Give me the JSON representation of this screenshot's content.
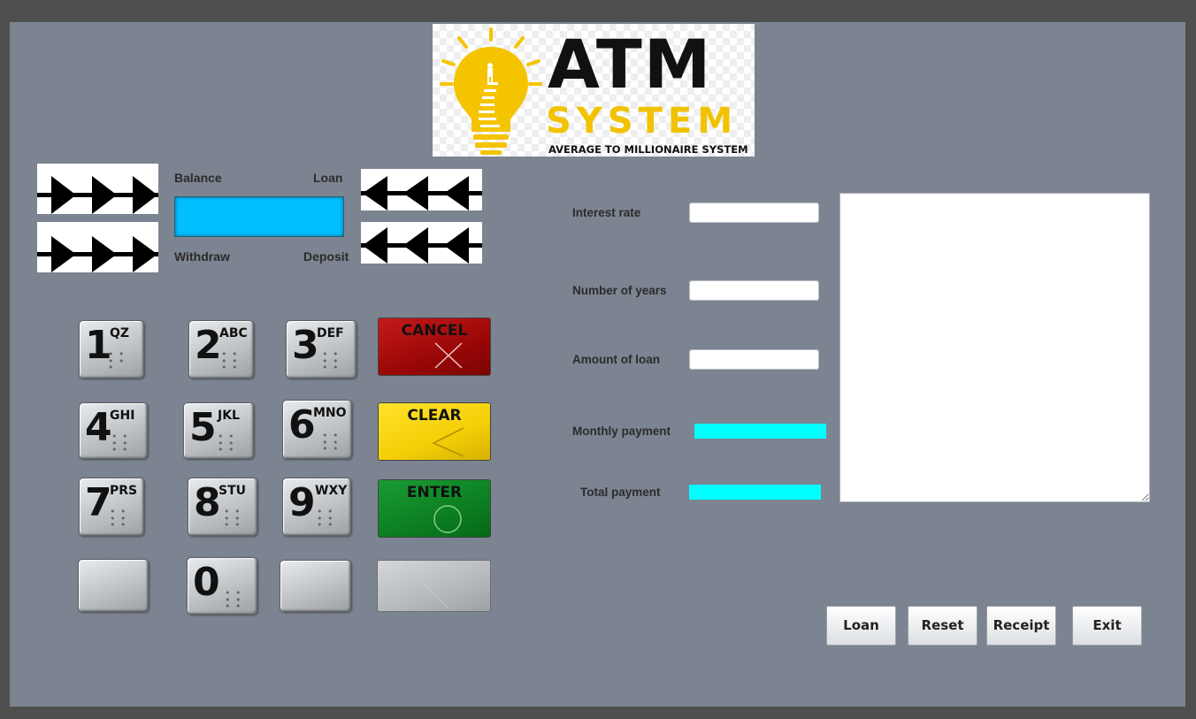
{
  "logo": {
    "title": "ATM",
    "subtitle": "SYSTEM",
    "tagline": "AVERAGE TO MILLIONAIRE SYSTEM"
  },
  "atm_panel": {
    "balance_label": "Balance",
    "loan_label": "Loan",
    "withdraw_label": "Withdraw",
    "deposit_label": "Deposit"
  },
  "keypad": {
    "keys": [
      {
        "digit": "1",
        "letters": "QZ"
      },
      {
        "digit": "2",
        "letters": "ABC"
      },
      {
        "digit": "3",
        "letters": "DEF"
      },
      {
        "digit": "4",
        "letters": "GHI"
      },
      {
        "digit": "5",
        "letters": "JKL"
      },
      {
        "digit": "6",
        "letters": "MNO"
      },
      {
        "digit": "7",
        "letters": "PRS"
      },
      {
        "digit": "8",
        "letters": "STU"
      },
      {
        "digit": "9",
        "letters": "WXY"
      },
      {
        "digit": "0",
        "letters": ""
      }
    ],
    "cancel_label": "CANCEL",
    "clear_label": "CLEAR",
    "enter_label": "ENTER",
    "colors": {
      "cancel": "#a30b0b",
      "clear": "#f4cf07",
      "enter": "#0c7f22"
    }
  },
  "loan_form": {
    "interest_rate_label": "Interest rate",
    "interest_rate_value": "",
    "number_of_years_label": "Number of years",
    "number_of_years_value": "",
    "amount_of_loan_label": "Amount of loan",
    "amount_of_loan_value": "",
    "monthly_payment_label": "Monthly payment",
    "monthly_payment_value": "",
    "total_payment_label": "Total payment",
    "total_payment_value": ""
  },
  "receipt": {
    "text": ""
  },
  "buttons": {
    "loan_label": "Loan",
    "reset_label": "Reset",
    "receipt_label": "Receipt",
    "exit_label": "Exit"
  },
  "colors": {
    "panel_background": "#7c8491",
    "frame": "#4f4f4f",
    "screen_display": "#00bfff",
    "output_fields": "#00ffff"
  }
}
